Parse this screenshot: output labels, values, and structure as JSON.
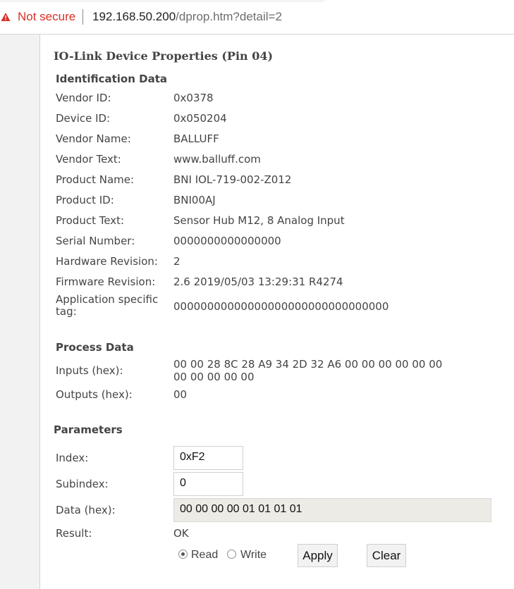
{
  "browser": {
    "security_label": "Not secure",
    "url_host": "192.168.50.200",
    "url_path": "/dprop.htm?detail=2"
  },
  "page": {
    "title": "IO-Link Device Properties (Pin 04)"
  },
  "identification": {
    "heading": "Identification Data",
    "rows": [
      {
        "label": "Vendor ID:",
        "value": "0x0378"
      },
      {
        "label": "Device ID:",
        "value": "0x050204"
      },
      {
        "label": "Vendor Name:",
        "value": "BALLUFF"
      },
      {
        "label": "Vendor Text:",
        "value": "www.balluff.com"
      },
      {
        "label": "Product Name:",
        "value": "BNI IOL-719-002-Z012"
      },
      {
        "label": "Product ID:",
        "value": "BNI00AJ"
      },
      {
        "label": "Product Text:",
        "value": "Sensor Hub M12, 8 Analog Input"
      },
      {
        "label": "Serial Number:",
        "value": "0000000000000000"
      },
      {
        "label": "Hardware Revision:",
        "value": "2"
      },
      {
        "label": "Firmware Revision:",
        "value": "2.6 2019/05/03 13:29:31 R4274"
      },
      {
        "label": "Application specific tag:",
        "value": "00000000000000000000000000000000"
      }
    ]
  },
  "process": {
    "heading": "Process Data",
    "inputs_label": "Inputs (hex):",
    "inputs_value": "00 00 28 8C 28 A9 34 2D 32 A6 00 00 00 00 00 00 00 00 00 00 00",
    "outputs_label": "Outputs (hex):",
    "outputs_value": "00"
  },
  "parameters": {
    "heading": "Parameters",
    "index_label": "Index:",
    "index_value": "0xF2",
    "subindex_label": "Subindex:",
    "subindex_value": "0",
    "data_label": "Data (hex):",
    "data_value": "00 00 00 00 01 01 01 01",
    "result_label": "Result:",
    "result_value": "OK",
    "read_label": "Read",
    "write_label": "Write",
    "apply_label": "Apply",
    "clear_label": "Clear"
  },
  "colors": {
    "warning": "#d93025",
    "readonly_field": "#ecebe6"
  }
}
